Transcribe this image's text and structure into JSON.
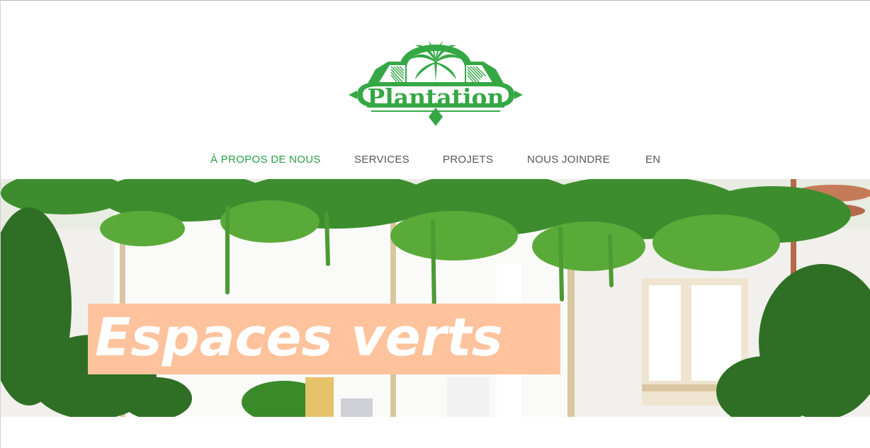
{
  "brand": {
    "name": "Plantation",
    "primary_color": "#35a845",
    "logo_icon": "palm-tree-arch-logo"
  },
  "nav": {
    "items": [
      {
        "label": "À PROPOS DE NOUS",
        "active": true
      },
      {
        "label": "SERVICES",
        "active": false
      },
      {
        "label": "PROJETS",
        "active": false
      },
      {
        "label": "NOUS JOINDRE",
        "active": false
      },
      {
        "label": "EN",
        "active": false
      }
    ],
    "active_color": "#2a9d47",
    "inactive_color": "#555555"
  },
  "hero": {
    "title": "Espaces verts",
    "title_bg": "#fec39c",
    "image": "indoor-plants-photo"
  }
}
